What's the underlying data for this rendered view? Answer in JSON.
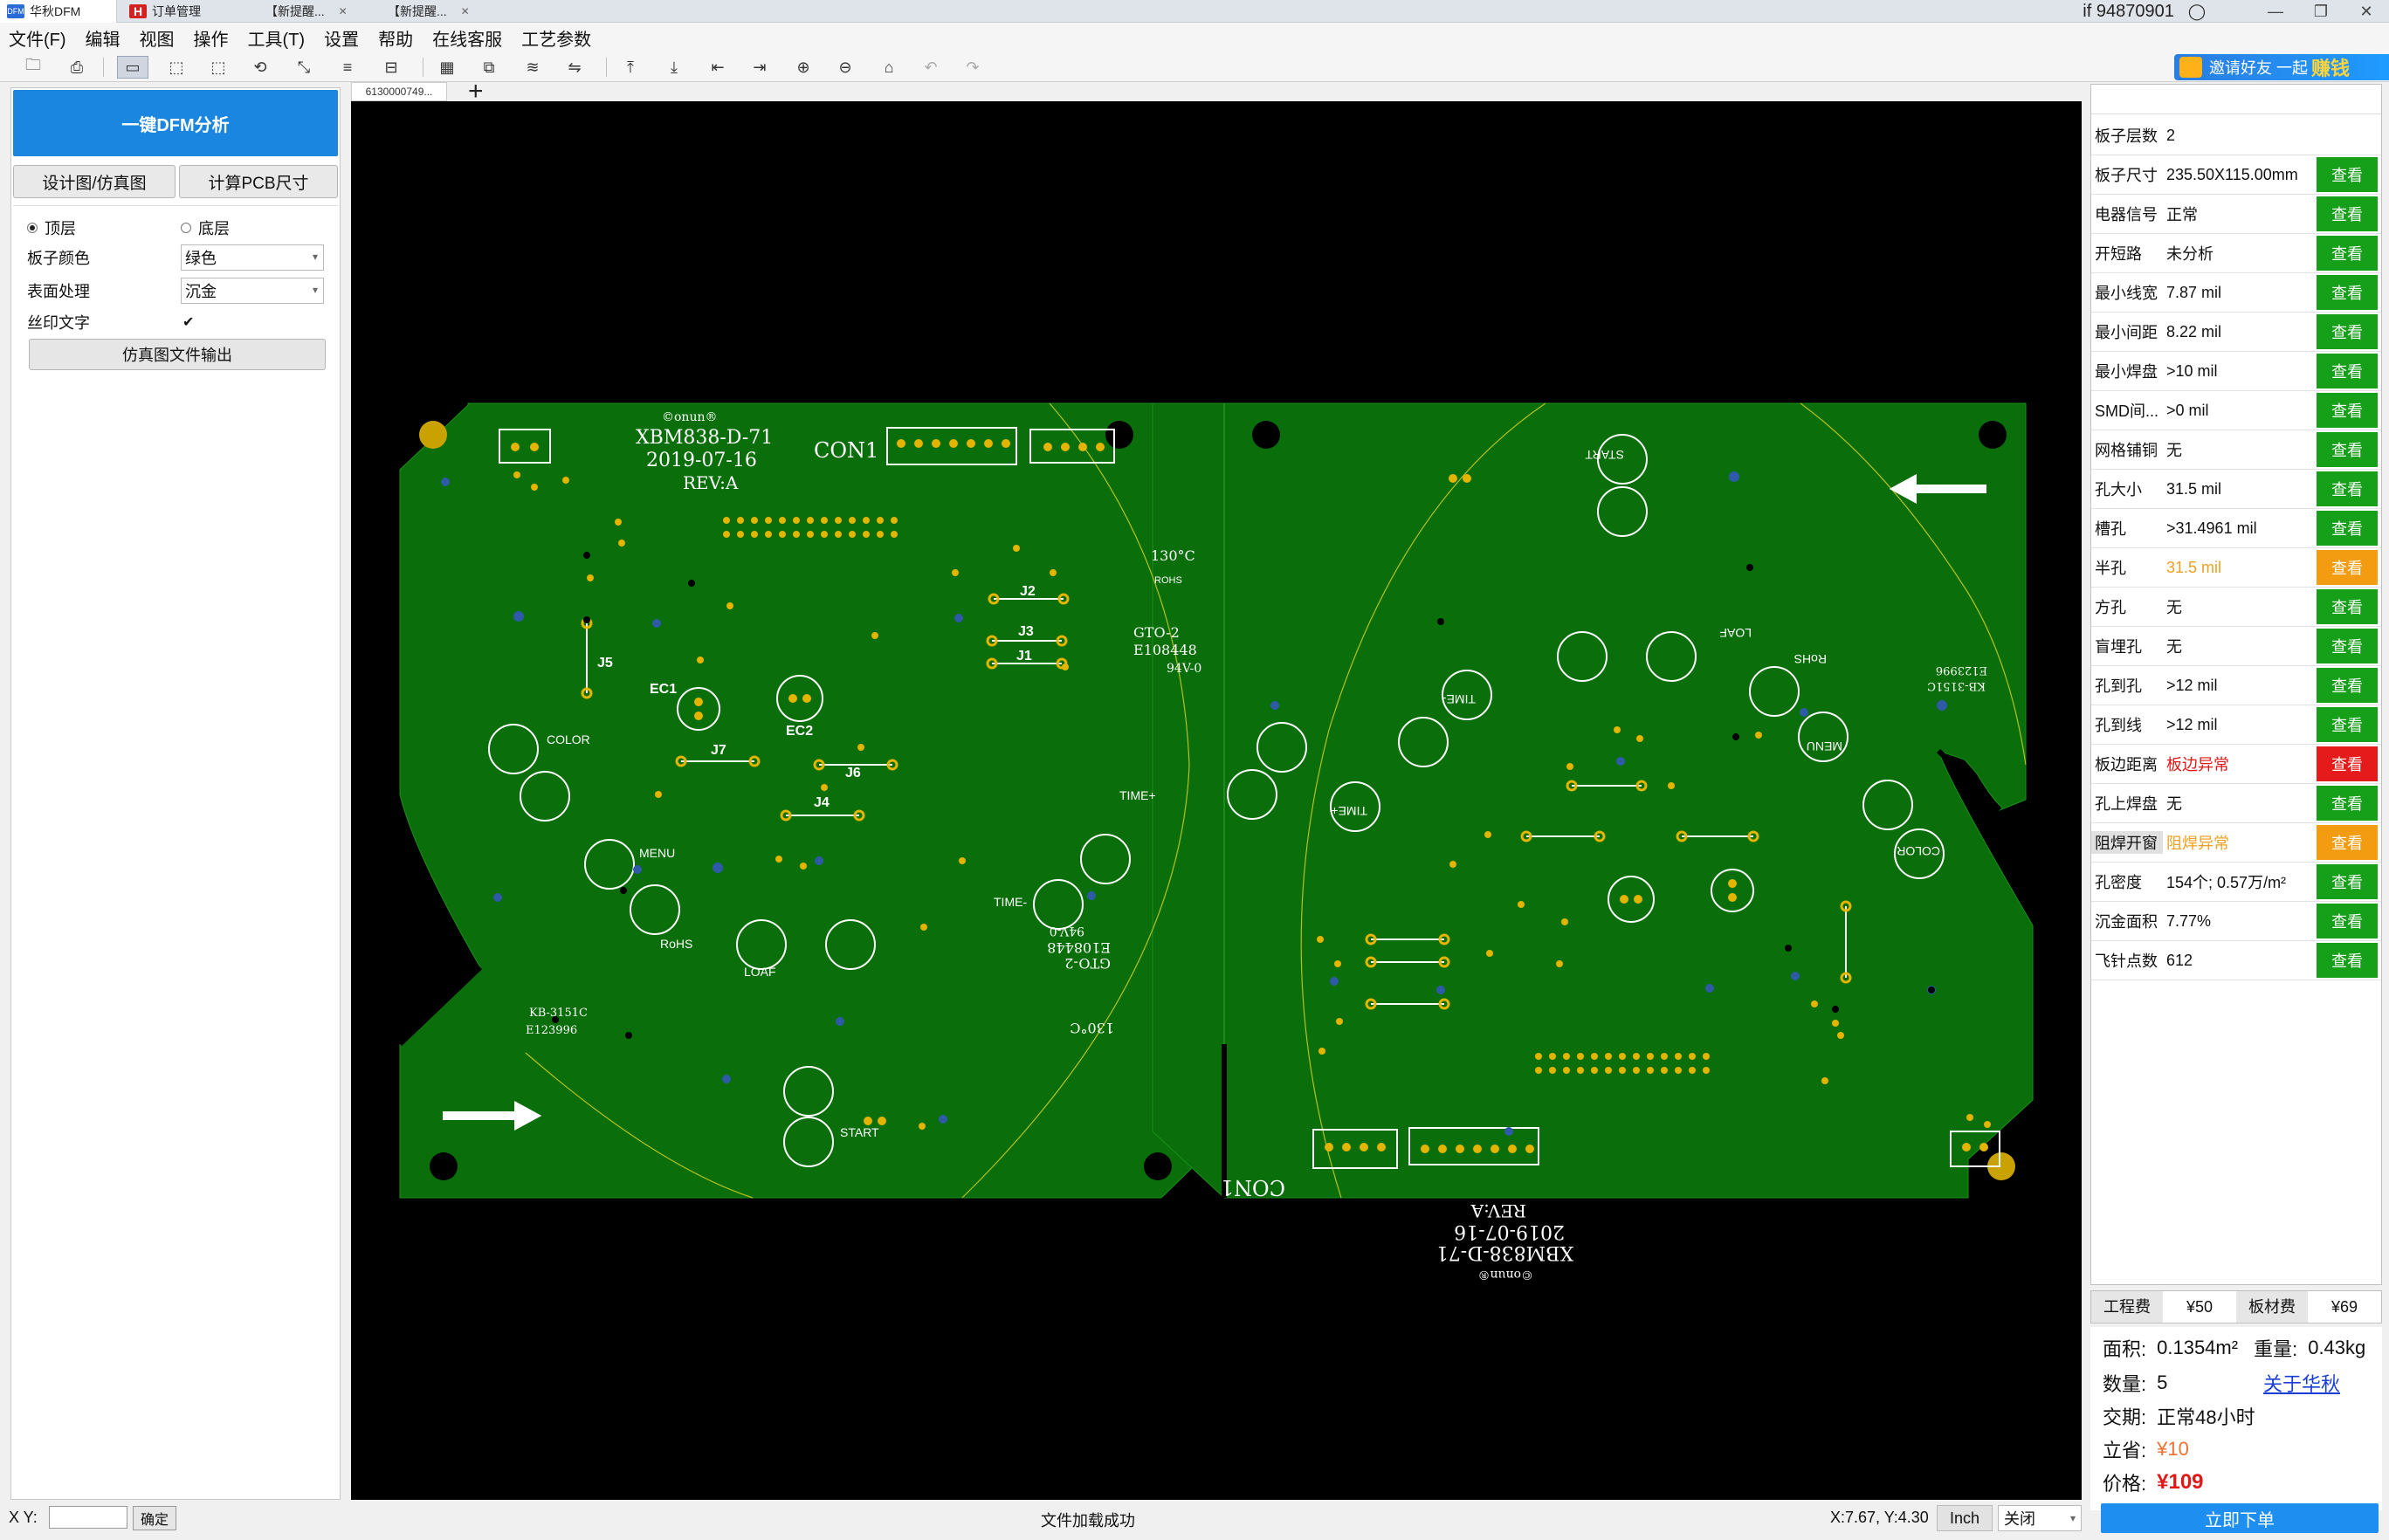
{
  "tabs": [
    {
      "label": "华秋DFM",
      "active": true
    },
    {
      "label": "订单管理",
      "active": false
    },
    {
      "label": "【新提醒...",
      "active": false
    },
    {
      "label": "【新提醒...",
      "active": false
    }
  ],
  "user": "if 94870901",
  "menu": [
    "文件(F)",
    "编辑",
    "视图",
    "操作",
    "工具(T)",
    "设置",
    "帮助",
    "在线客服",
    "工艺参数"
  ],
  "promo": {
    "text": "邀请好友 一起",
    "highlight": "赚钱"
  },
  "left_panel": {
    "dfm_button": "一键DFM分析",
    "design_button": "设计图/仿真图",
    "calc_button": "计算PCB尺寸",
    "top_layer": "顶层",
    "bottom_layer": "底层",
    "board_color_label": "板子颜色",
    "board_color_value": "绿色",
    "surface_label": "表面处理",
    "surface_value": "沉金",
    "silk_label": "丝印文字",
    "silk_check": "✔",
    "export_button": "仿真图文件输出"
  },
  "doc_tab": "6130000749...",
  "board": {
    "title": "XBM838-D-71",
    "date": "2019-07-16",
    "rev": "REV:A",
    "con": "CON1",
    "temp": "130°C",
    "gto": "GTO-2",
    "cert": "E108448",
    "grade": "94V-0",
    "kb": "KB-3151C",
    "e_code": "E123996",
    "labels": {
      "j1": "J1",
      "j2": "J2",
      "j3": "J3",
      "j4": "J4",
      "j5": "J5",
      "j6": "J6",
      "j7": "J7",
      "ec1": "EC1",
      "ec2": "EC2",
      "color": "COLOR",
      "menu": "MENU",
      "rohs": "RoHS",
      "loaf": "LOAF",
      "start": "START",
      "time_plus": "TIME+",
      "time_minus": "TIME-",
      "rohs_mark": "ROHS",
      "logo": "©onun®"
    }
  },
  "right_panel": {
    "view_label": "查看",
    "rows": [
      {
        "label": "板子层数",
        "value": "2",
        "btn": "none",
        "value_color": "#111"
      },
      {
        "label": "板子尺寸",
        "value": "235.50X115.00mm",
        "btn": "green",
        "value_color": "#111"
      },
      {
        "label": "电器信号",
        "value": "正常",
        "btn": "green",
        "value_color": "#111"
      },
      {
        "label": "开短路",
        "value": "未分析",
        "btn": "green",
        "value_color": "#111"
      },
      {
        "label": "最小线宽",
        "value": "7.87 mil",
        "btn": "green",
        "value_color": "#111"
      },
      {
        "label": "最小间距",
        "value": "8.22 mil",
        "btn": "green",
        "value_color": "#111"
      },
      {
        "label": "最小焊盘",
        "value": ">10 mil",
        "btn": "green",
        "value_color": "#111"
      },
      {
        "label": "SMD间...",
        "value": ">0 mil",
        "btn": "green",
        "value_color": "#111"
      },
      {
        "label": "网格铺铜",
        "value": "无",
        "btn": "green",
        "value_color": "#111"
      },
      {
        "label": "孔大小",
        "value": "31.5 mil",
        "btn": "green",
        "value_color": "#111"
      },
      {
        "label": "槽孔",
        "value": ">31.4961 mil",
        "btn": "green",
        "value_color": "#111"
      },
      {
        "label": "半孔",
        "value": "31.5 mil",
        "btn": "orange",
        "value_color": "#f0a020"
      },
      {
        "label": "方孔",
        "value": "无",
        "btn": "green",
        "value_color": "#111"
      },
      {
        "label": "盲埋孔",
        "value": "无",
        "btn": "green",
        "value_color": "#111"
      },
      {
        "label": "孔到孔",
        "value": ">12 mil",
        "btn": "green",
        "value_color": "#111"
      },
      {
        "label": "孔到线",
        "value": ">12 mil",
        "btn": "green",
        "value_color": "#111"
      },
      {
        "label": "板边距离",
        "value": "板边异常",
        "btn": "red",
        "value_color": "#e01818"
      },
      {
        "label": "孔上焊盘",
        "value": "无",
        "btn": "green",
        "value_color": "#111"
      },
      {
        "label": "阻焊开窗",
        "value": "阻焊异常",
        "btn": "orange",
        "value_color": "#f0a020"
      },
      {
        "label": "孔密度",
        "value": "154个; 0.57万/m²",
        "btn": "green",
        "value_color": "#111"
      },
      {
        "label": "沉金面积",
        "value": "7.77%",
        "btn": "green",
        "value_color": "#111"
      },
      {
        "label": "飞针点数",
        "value": "612",
        "btn": "green",
        "value_color": "#111"
      }
    ]
  },
  "fees": {
    "eng_label": "工程费",
    "eng_value": "¥50",
    "board_label": "板材费",
    "board_value": "¥69"
  },
  "pricing": {
    "area_label": "面积:",
    "area_value": "0.1354m²",
    "weight_label": "重量:",
    "weight_value": "0.43kg",
    "qty_label": "数量:",
    "qty_value": "5",
    "about": "关于华秋",
    "delivery_label": "交期:",
    "delivery_value": "正常48小时",
    "save_label": "立省:",
    "save_value": "¥10",
    "price_label": "价格:",
    "price_value": "¥109",
    "order_button": "立即下单"
  },
  "status": {
    "xy_label": "X Y:",
    "confirm": "确定",
    "message": "文件加载成功",
    "coords": "X:7.67, Y:4.30",
    "unit": "Inch",
    "close": "关闭"
  }
}
